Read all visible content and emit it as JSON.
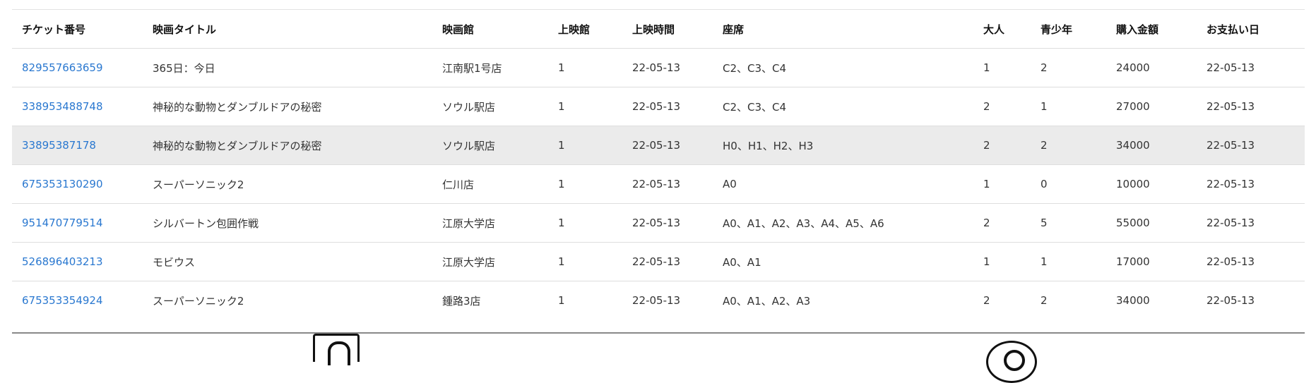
{
  "table": {
    "headers": [
      "チケット番号",
      "映画タイトル",
      "映画館",
      "上映館",
      "上映時間",
      "座席",
      "大人",
      "青少年",
      "購入金額",
      "お支払い日"
    ],
    "rows": [
      [
        "829557663659",
        "365日：今日",
        "江南駅1号店",
        "1",
        "22-05-13",
        "C2、C3、C4",
        "1",
        "2",
        "24000",
        "22-05-13"
      ],
      [
        "338953488748",
        "神秘的な動物とダンブルドアの秘密",
        "ソウル駅店",
        "1",
        "22-05-13",
        "C2、C3、C4",
        "2",
        "1",
        "27000",
        "22-05-13"
      ],
      [
        "33895387178",
        "神秘的な動物とダンブルドアの秘密",
        "ソウル駅店",
        "1",
        "22-05-13",
        "H0、H1、H2、H3",
        "2",
        "2",
        "34000",
        "22-05-13"
      ],
      [
        "675353130290",
        "スーパーソニック2",
        "仁川店",
        "1",
        "22-05-13",
        "A0",
        "1",
        "0",
        "10000",
        "22-05-13"
      ],
      [
        "951470779514",
        "シルバートン包囲作戦",
        "江原大学店",
        "1",
        "22-05-13",
        "A0、A1、A2、A3、A4、A5、A6",
        "2",
        "5",
        "55000",
        "22-05-13"
      ],
      [
        "526896403213",
        "モビウス",
        "江原大学店",
        "1",
        "22-05-13",
        "A0、A1",
        "1",
        "1",
        "17000",
        "22-05-13"
      ],
      [
        "675353354924",
        "スーパーソニック2",
        "鍾路3店",
        "1",
        "22-05-13",
        "A0、A1、A2、A3",
        "2",
        "2",
        "34000",
        "22-05-13"
      ]
    ],
    "highlighted_row": 2
  },
  "colors": {
    "link": "#2a78d0",
    "highlight_row": "#ebebeb"
  },
  "footer_icons": [
    "app-icon",
    "circle-icon"
  ]
}
